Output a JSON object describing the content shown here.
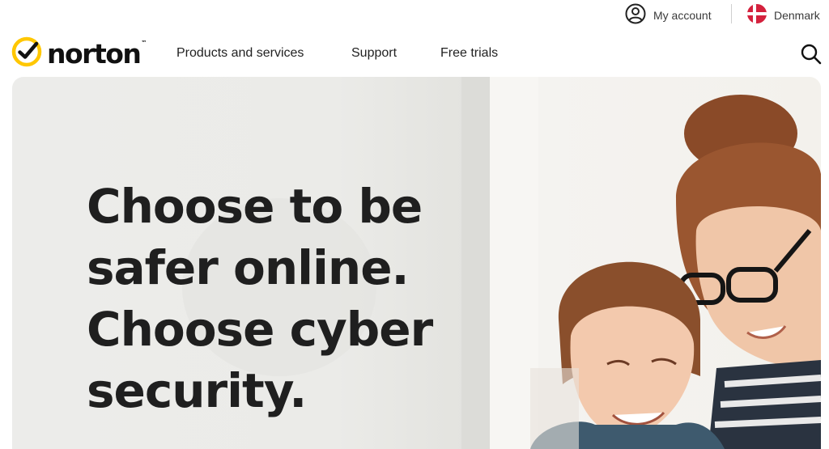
{
  "utility": {
    "account_label": "My account",
    "country_label": "Denmark"
  },
  "brand": {
    "logo_text": "norton",
    "logo_tm": "™",
    "accent_color": "#FFC700"
  },
  "nav": {
    "items": [
      {
        "label": "Products and services"
      },
      {
        "label": "Support"
      },
      {
        "label": "Free trials"
      }
    ]
  },
  "hero": {
    "title_lines": [
      "Choose to be",
      "safer online.",
      "Choose cyber",
      "security."
    ]
  },
  "icons": {
    "account": "user-circle-icon",
    "flag": "denmark-flag-icon",
    "search": "search-icon",
    "logo": "checkmark-logo-icon"
  }
}
